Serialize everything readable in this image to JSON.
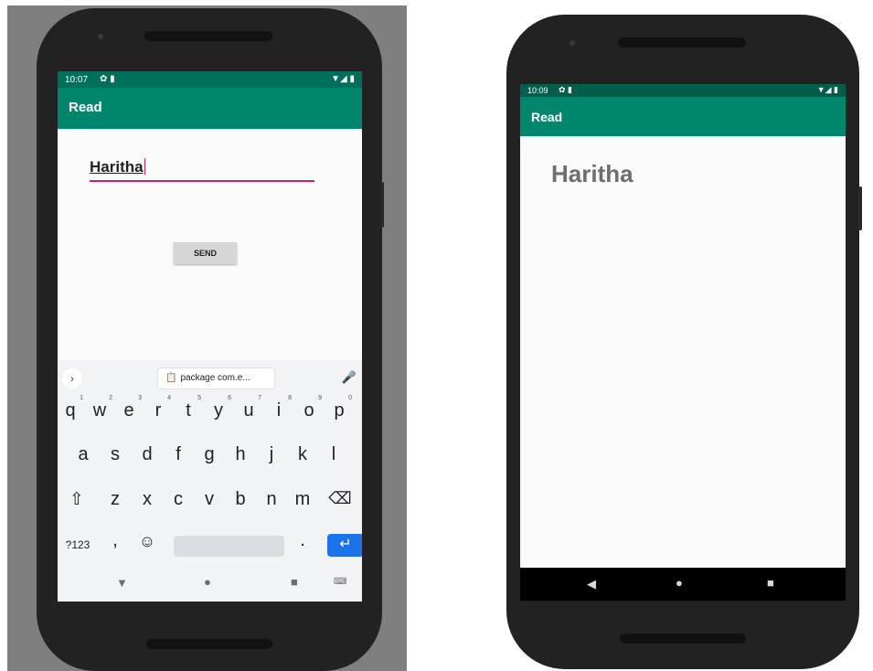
{
  "left_phone": {
    "status_bar": {
      "time": "10:07",
      "left_icons": "✿ ▮",
      "right_icons": "▼◢ ▮"
    },
    "app_bar": {
      "title": "Read"
    },
    "edit_text": {
      "value": "Haritha"
    },
    "send_button": {
      "label": "SEND"
    },
    "keyboard": {
      "suggestion": {
        "expand": "›",
        "clipboard_icon": "📋",
        "chip_text": "package com.e...",
        "mic": "🎤"
      },
      "row1": [
        "q",
        "w",
        "e",
        "r",
        "t",
        "y",
        "u",
        "i",
        "o",
        "p"
      ],
      "row1_hints": [
        "1",
        "2",
        "3",
        "4",
        "5",
        "6",
        "7",
        "8",
        "9",
        "0"
      ],
      "row2": [
        "a",
        "s",
        "d",
        "f",
        "g",
        "h",
        "j",
        "k",
        "l"
      ],
      "row3": {
        "shift": "⇧",
        "keys": [
          "z",
          "x",
          "c",
          "v",
          "b",
          "n",
          "m"
        ],
        "backspace": "⌫"
      },
      "row4": {
        "symbols": "?123",
        "comma": ",",
        "emoji": "☺",
        "period": ".",
        "enter": "↵"
      }
    },
    "nav_bar": {
      "back": "▼",
      "home": "●",
      "recents": "■",
      "keyboard_switch": "⌨"
    }
  },
  "right_phone": {
    "status_bar": {
      "time": "10:09",
      "left_icons": "✿ ▮",
      "right_icons": "▼◢ ▮"
    },
    "app_bar": {
      "title": "Read"
    },
    "output_text": {
      "value": "Haritha"
    },
    "nav_bar": {
      "back": "◀",
      "home": "●",
      "recents": "■"
    }
  },
  "colors": {
    "app_bar": "#00866d",
    "status_bar": "#006f59",
    "accent": "#d81b60",
    "enter_key": "#1a73e8"
  }
}
